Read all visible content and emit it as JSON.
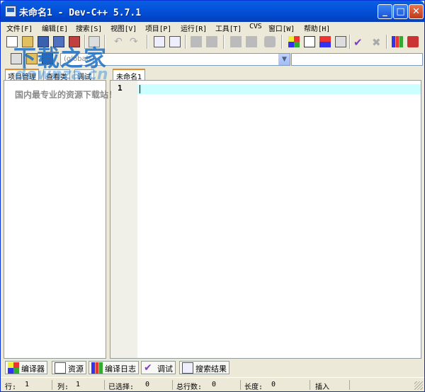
{
  "window": {
    "title": "未命名1 - Dev-C++ 5.7.1"
  },
  "menu": [
    "文件[F]",
    "编辑[E]",
    "搜索[S]",
    "视图[V]",
    "项目[P]",
    "运行[R]",
    "工具[T]",
    "CVS",
    "窗口[W]",
    "帮助[H]"
  ],
  "toolbar": {
    "combo_value": "(globals)"
  },
  "left_tabs": [
    "项目管理",
    "查看类",
    "调试"
  ],
  "editor": {
    "tab_label": "未命名1",
    "line_number": "1"
  },
  "bottom_tabs": [
    "编译器",
    "资源",
    "编译日志",
    "调试",
    "搜索结果"
  ],
  "status": {
    "row_label": "行:",
    "row_value": "1",
    "col_label": "列:",
    "col_value": "1",
    "sel_label": "已选择:",
    "sel_value": "0",
    "total_label": "总行数:",
    "total_value": "0",
    "len_label": "长度:",
    "len_value": "0",
    "mode": "插入"
  },
  "watermark": {
    "brand": "下载之家",
    "site": "downza.cn",
    "slogan": "国内最专业的资源下载站！"
  }
}
